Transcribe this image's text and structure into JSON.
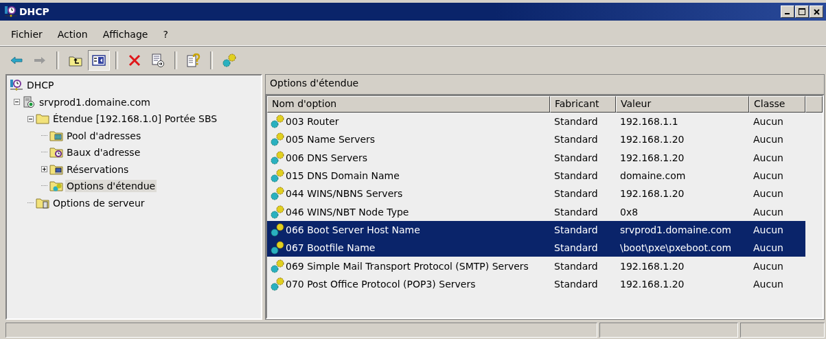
{
  "window": {
    "title": "DHCP"
  },
  "menu": [
    {
      "label": "Fichier"
    },
    {
      "label": "Action"
    },
    {
      "label": "Affichage"
    },
    {
      "label": "?"
    }
  ],
  "toolbar": [
    {
      "kind": "back",
      "pressed": false
    },
    {
      "kind": "forward",
      "pressed": false
    },
    {
      "kind": "up",
      "pressed": false
    },
    {
      "kind": "tree",
      "pressed": true
    },
    {
      "kind": "delete",
      "pressed": false
    },
    {
      "kind": "export",
      "pressed": false
    },
    {
      "kind": "help",
      "pressed": false
    },
    {
      "kind": "options",
      "pressed": false
    }
  ],
  "tree": [
    {
      "label": "DHCP",
      "kind": "root",
      "selected": false,
      "children": [
        {
          "label": "srvprod1.domaine.com",
          "kind": "server",
          "selected": false,
          "expanded": true,
          "children": [
            {
              "label": "Étendue [192.168.1.0] Portée SBS",
              "kind": "folder",
              "selected": false,
              "expanded": true,
              "children": [
                {
                  "label": "Pool d'adresses",
                  "kind": "pool",
                  "selected": false
                },
                {
                  "label": "Baux d'adresse",
                  "kind": "leases",
                  "selected": false
                },
                {
                  "label": "Réservations",
                  "kind": "reservations",
                  "selected": false,
                  "expanded": false
                },
                {
                  "label": "Options d'étendue",
                  "kind": "options",
                  "selected": true
                }
              ]
            },
            {
              "label": "Options de serveur",
              "kind": "server-options",
              "selected": false
            }
          ]
        }
      ]
    }
  ],
  "details": {
    "title": "Options d'étendue",
    "columns": [
      "Nom d'option",
      "Fabricant",
      "Valeur",
      "Classe"
    ],
    "rows": [
      {
        "name": "003 Router",
        "vendor": "Standard",
        "value": "192.168.1.1",
        "class": "Aucun",
        "selected": false
      },
      {
        "name": "005 Name Servers",
        "vendor": "Standard",
        "value": "192.168.1.20",
        "class": "Aucun",
        "selected": false
      },
      {
        "name": "006 DNS Servers",
        "vendor": "Standard",
        "value": "192.168.1.20",
        "class": "Aucun",
        "selected": false
      },
      {
        "name": "015 DNS Domain Name",
        "vendor": "Standard",
        "value": "domaine.com",
        "class": "Aucun",
        "selected": false
      },
      {
        "name": "044 WINS/NBNS Servers",
        "vendor": "Standard",
        "value": "192.168.1.20",
        "class": "Aucun",
        "selected": false
      },
      {
        "name": "046 WINS/NBT Node Type",
        "vendor": "Standard",
        "value": "0x8",
        "class": "Aucun",
        "selected": false
      },
      {
        "name": "066 Boot Server Host Name",
        "vendor": "Standard",
        "value": "srvprod1.domaine.com",
        "class": "Aucun",
        "selected": true
      },
      {
        "name": "067 Bootfile Name",
        "vendor": "Standard",
        "value": "\\boot\\pxe\\pxeboot.com",
        "class": "Aucun",
        "selected": true
      },
      {
        "name": "069 Simple Mail Transport Protocol (SMTP) Servers",
        "vendor": "Standard",
        "value": "192.168.1.20",
        "class": "Aucun",
        "selected": false
      },
      {
        "name": "070 Post Office Protocol (POP3) Servers",
        "vendor": "Standard",
        "value": "192.168.1.20",
        "class": "Aucun",
        "selected": false
      }
    ]
  }
}
